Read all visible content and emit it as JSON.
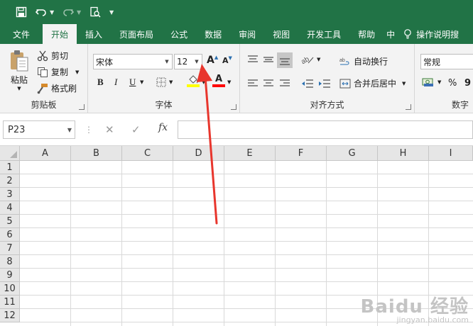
{
  "quick_access": {
    "icons": [
      "save-icon",
      "undo-icon",
      "redo-icon",
      "print-preview-icon",
      "customize-icon"
    ]
  },
  "ribbon_tabs": [
    {
      "label": "文件",
      "active": false
    },
    {
      "label": "开始",
      "active": true
    },
    {
      "label": "插入",
      "active": false
    },
    {
      "label": "页面布局",
      "active": false
    },
    {
      "label": "公式",
      "active": false
    },
    {
      "label": "数据",
      "active": false
    },
    {
      "label": "审阅",
      "active": false
    },
    {
      "label": "视图",
      "active": false
    },
    {
      "label": "开发工具",
      "active": false
    },
    {
      "label": "帮助",
      "active": false
    },
    {
      "label": "中",
      "active": false
    }
  ],
  "tell_me": "操作说明搜",
  "clipboard": {
    "paste": "粘贴",
    "cut": "剪切",
    "copy": "复制",
    "format_painter": "格式刷",
    "label": "剪贴板"
  },
  "font": {
    "name": "宋体",
    "size": "12",
    "label": "字体",
    "bold": "B",
    "italic": "I",
    "underline": "U",
    "grow": "A",
    "shrink": "A",
    "font_color_letter": "A",
    "highlight_color": "#ffff00",
    "font_color": "#ff0000"
  },
  "alignment": {
    "wrap_text": "自动换行",
    "merge_center": "合并后居中",
    "label": "对齐方式"
  },
  "number": {
    "format": "常规",
    "percent": "%",
    "comma": "9",
    "label": "数字"
  },
  "formula_bar": {
    "name_box": "P23",
    "fx": "fx",
    "formula": ""
  },
  "columns": [
    "A",
    "B",
    "C",
    "D",
    "E",
    "F",
    "G",
    "H",
    "I"
  ],
  "rows": [
    "1",
    "2",
    "3",
    "4",
    "5",
    "6",
    "7",
    "8",
    "9",
    "10",
    "11",
    "12"
  ],
  "annotation_color": "#e8362d",
  "watermark": {
    "brand": "Baidu 经验",
    "site": "jingyan.baidu.com"
  }
}
